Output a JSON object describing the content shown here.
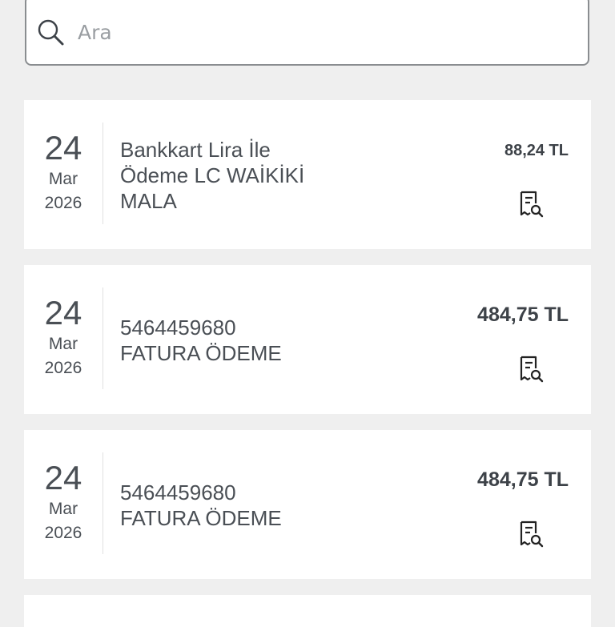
{
  "search": {
    "placeholder": "Ara",
    "icon": "search-icon"
  },
  "transactions": [
    {
      "day": "24",
      "month": "Mar",
      "year": "2026",
      "description": "Bankkart Lira İle\nÖdeme  LC WAİKİKİ\nMALA",
      "amount": "88,24 TL",
      "icon": "receipt-search-icon"
    },
    {
      "day": "24",
      "month": "Mar",
      "year": "2026",
      "description": "5464459680\nFATURA ÖDEME",
      "amount": "484,75 TL",
      "icon": "receipt-search-icon"
    },
    {
      "day": "24",
      "month": "Mar",
      "year": "2026",
      "description": "5464459680\nFATURA ÖDEME",
      "amount": "484,75 TL",
      "icon": "receipt-search-icon"
    }
  ],
  "colors": {
    "background": "#efefef",
    "card": "#ffffff",
    "text": "#3d4248"
  }
}
